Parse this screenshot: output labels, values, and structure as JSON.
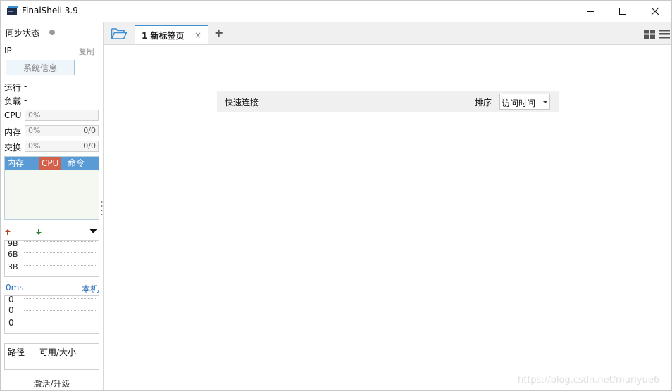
{
  "window": {
    "title": "FinalShell 3.9"
  },
  "sidebar": {
    "sync_status": "同步状态",
    "ip_label": "IP",
    "ip_value": "-",
    "copy": "复制",
    "sysinfo_button": "系统信息",
    "uptime_label": "运行",
    "uptime_value": "-",
    "load_label": "负载",
    "load_value": "-",
    "cpu_label": "CPU",
    "cpu_pct": "0%",
    "mem_label": "内存",
    "mem_pct": "0%",
    "mem_ratio": "0/0",
    "swap_label": "交换",
    "swap_pct": "0%",
    "swap_ratio": "0/0",
    "proc_tabs": [
      "内存",
      "CPU",
      "命令"
    ],
    "net_labels": [
      "9B",
      "6B",
      "3B"
    ],
    "ping_ms": "0ms",
    "ping_host": "本机",
    "ping_labels": [
      "0",
      "0",
      "0"
    ],
    "path_col": "路径",
    "space_col": "可用/大小",
    "upgrade": "激活/升级"
  },
  "tabs": [
    {
      "label": "1 新标签页",
      "close": "×"
    }
  ],
  "add_tab": "+",
  "quick": {
    "title": "快速连接",
    "sort_label": "排序",
    "sort_value": "访问时间"
  },
  "watermark": "https://blog.csdn.net/muriyue6",
  "colors": {
    "accent": "#3d8fd6",
    "proc_header": "#5a9bd5",
    "proc_cpu": "#d4604a",
    "upload_arrow": "#b5412a",
    "download_arrow": "#2f7d32"
  }
}
